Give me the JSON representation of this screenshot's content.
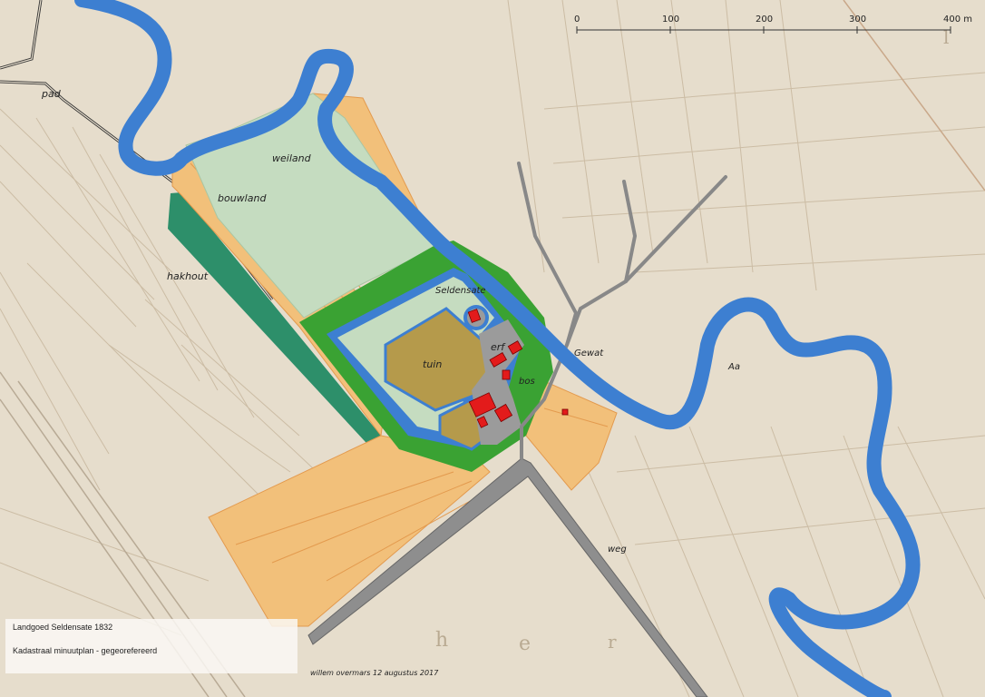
{
  "scale_bar": {
    "ticks": [
      "0",
      "100",
      "200",
      "300",
      "400 m"
    ]
  },
  "labels": {
    "pad": "pad",
    "weiland": "weiland",
    "bouwland": "bouwland",
    "hakhout": "hakhout",
    "seldensate": "Seldensate",
    "erf": "erf",
    "tuin": "tuin",
    "bos": "bos",
    "gewat": "Gewat",
    "aa": "Aa",
    "weg": "weg"
  },
  "legend": {
    "title": "Landgoed Seldensate 1832",
    "subtitle": "Kadastraal minuutplan - gegeorefereerd"
  },
  "credit": "willem overmars 12 augustus 2017",
  "colors": {
    "water": "#3d7fd1",
    "arable": "#f2c07a",
    "meadow": "#c5dcc0",
    "woodland": "#3aa233",
    "garden": "#b59a4b",
    "yard": "#9b9b9b",
    "building": "#e31b1b",
    "road": "#8e8e8e",
    "coppice": "#2d8f6a"
  }
}
